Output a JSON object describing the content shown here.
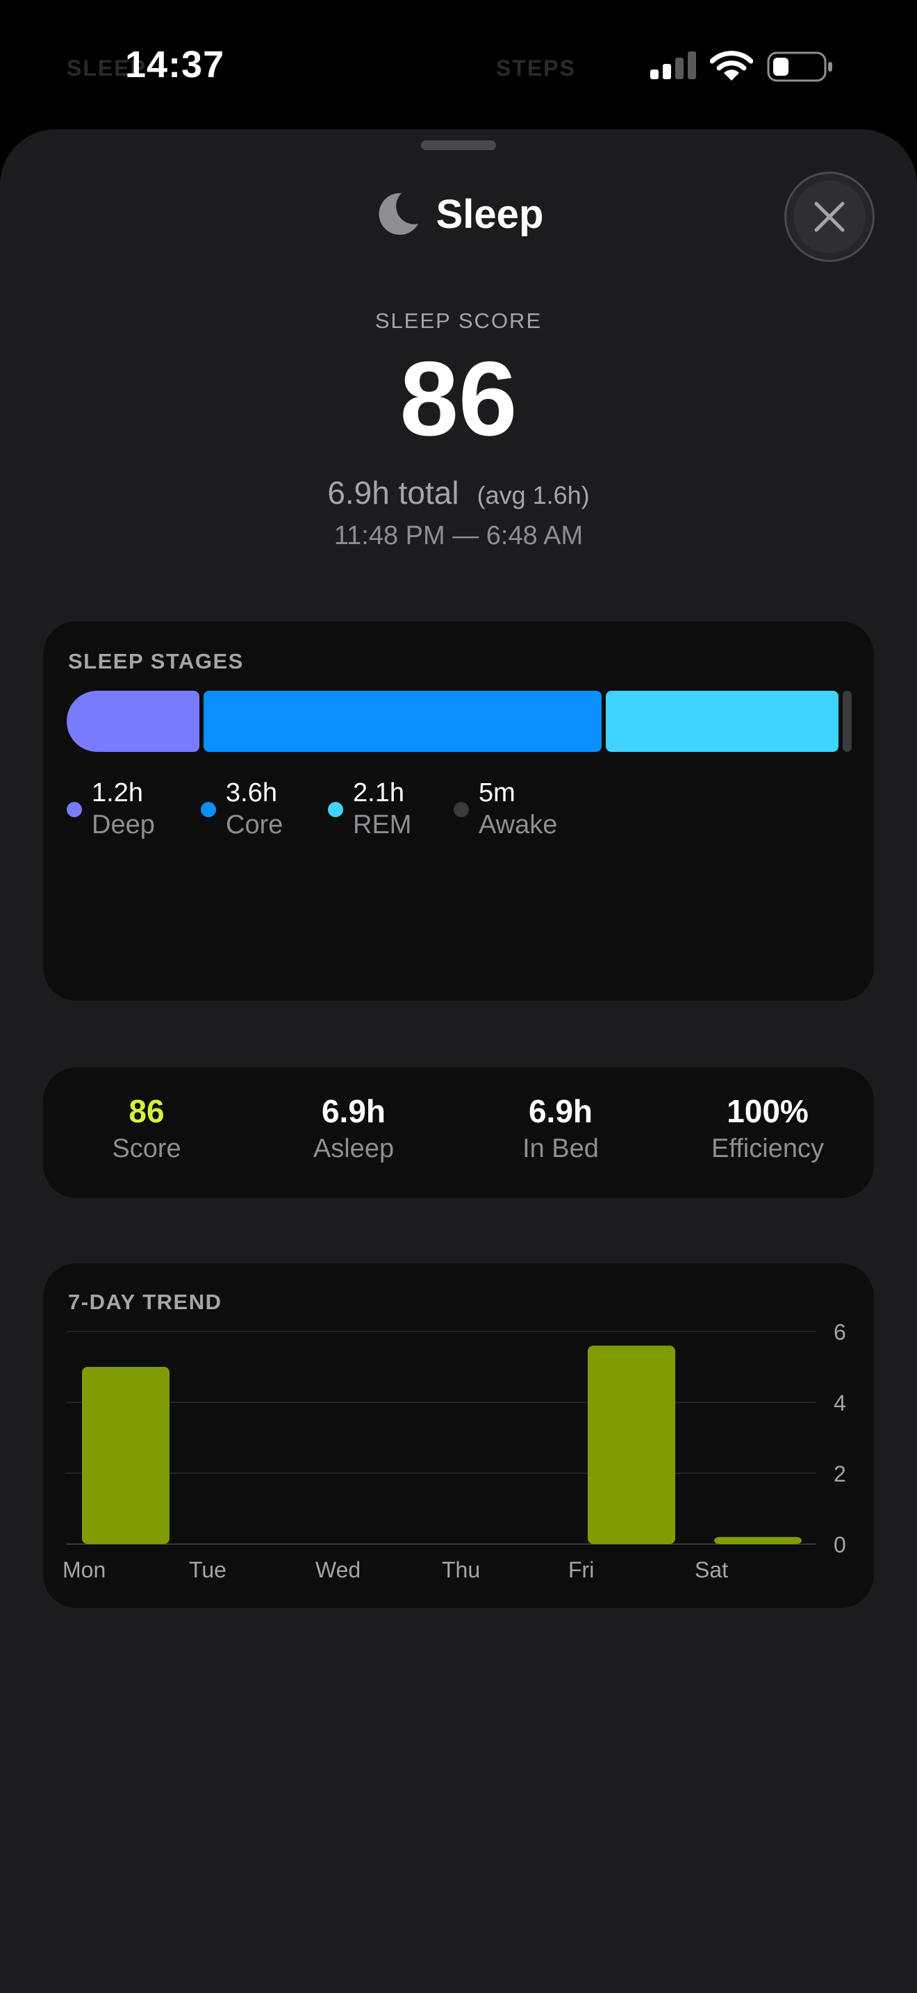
{
  "status_bar": {
    "time": "14:37",
    "background_tabs": [
      "SLEEP",
      "STEPS"
    ],
    "icons": [
      "cellular-signal-icon",
      "wifi-icon",
      "battery-icon"
    ]
  },
  "sheet": {
    "title": "Sleep",
    "title_icon": "moon-icon",
    "close_icon": "close-icon"
  },
  "summary": {
    "score_label": "SLEEP SCORE",
    "score": "86",
    "total": "6.9h total",
    "avg": "(avg 1.6h)",
    "time_range": "11:48 PM — 6:48 AM"
  },
  "stages": {
    "title": "SLEEP STAGES",
    "items": [
      {
        "value": "1.2h",
        "label": "Deep",
        "hours": 1.2,
        "color": "#7a7cff"
      },
      {
        "value": "3.6h",
        "label": "Core",
        "hours": 3.6,
        "color": "#0a8fff"
      },
      {
        "value": "2.1h",
        "label": "REM",
        "hours": 2.1,
        "color": "#3fd4ff"
      },
      {
        "value": "5m",
        "label": "Awake",
        "hours": 0.0833,
        "color": "#3a3a3c"
      }
    ]
  },
  "stats": [
    {
      "value": "86",
      "label": "Score",
      "color": "#d4f23a"
    },
    {
      "value": "6.9h",
      "label": "Asleep",
      "color": "#ffffff"
    },
    {
      "value": "6.9h",
      "label": "In Bed",
      "color": "#ffffff"
    },
    {
      "value": "100%",
      "label": "Efficiency",
      "color": "#ffffff"
    }
  ],
  "chart_data": {
    "type": "bar",
    "title": "7-DAY TREND",
    "categories": [
      "Mon",
      "Tue",
      "Wed",
      "Thu",
      "Fri",
      "Sat"
    ],
    "values": [
      5.0,
      0,
      0,
      0,
      5.6,
      0.2
    ],
    "ylim": [
      0,
      6
    ],
    "yticks": [
      "0",
      "2",
      "4",
      "6"
    ],
    "grid": true,
    "bar_color": "#7f9c05"
  }
}
